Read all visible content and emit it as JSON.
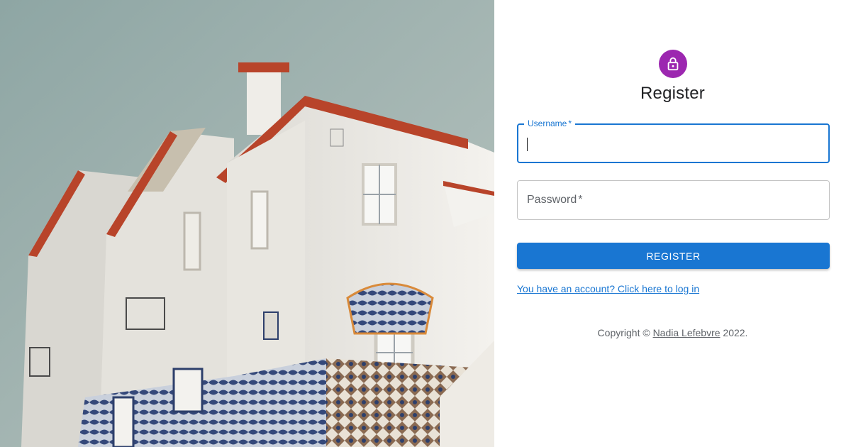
{
  "colors": {
    "primary": "#1976d2",
    "avatar": "#9c27b0",
    "title_text": "#202124",
    "muted_text": "#5f6368"
  },
  "hero": {
    "icon": "building-photo"
  },
  "header": {
    "avatar_icon": "lock-icon",
    "title": "Register"
  },
  "form": {
    "username": {
      "label": "Username",
      "required_mark": "*",
      "value": ""
    },
    "password": {
      "label": "Password",
      "required_mark": "*",
      "value": ""
    },
    "submit_label": "REGISTER"
  },
  "login_link": "You have an account? Click here to log in",
  "footer": {
    "prefix": "Copyright © ",
    "author": "Nadia Lefebvre",
    "suffix": " 2022."
  }
}
